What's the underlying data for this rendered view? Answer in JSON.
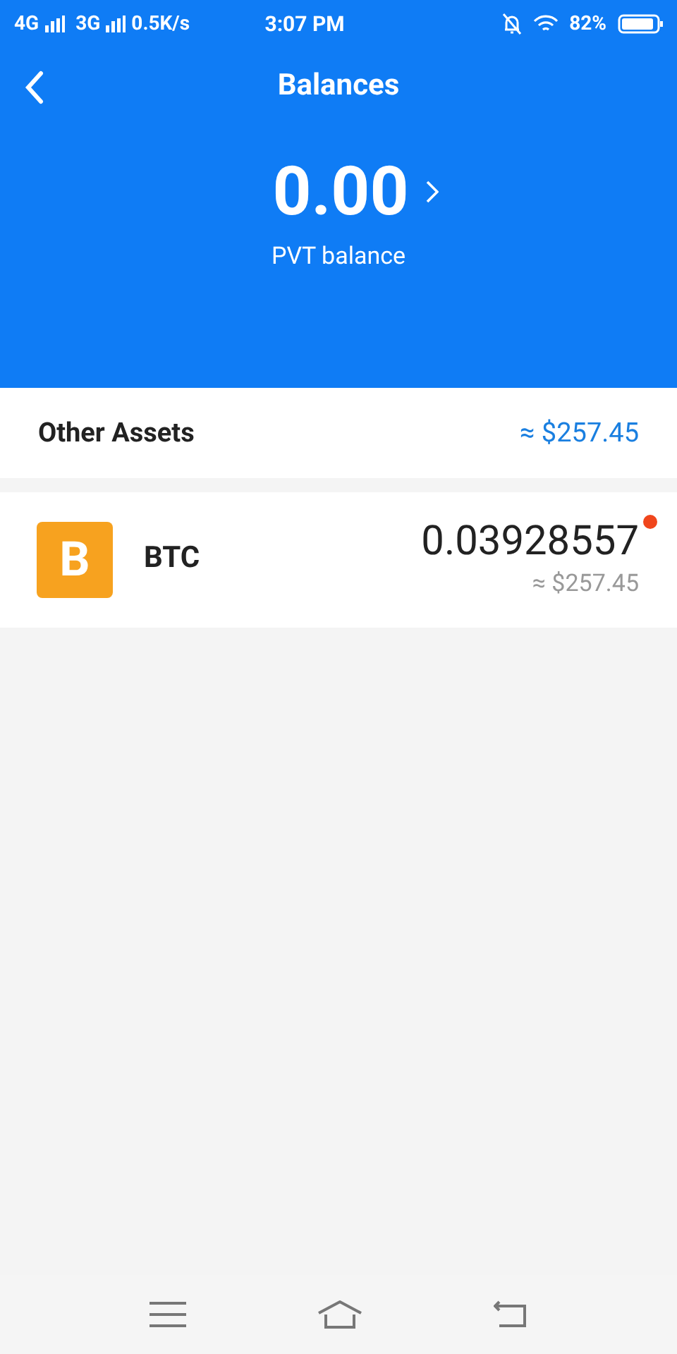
{
  "status_bar": {
    "network_1": "4G",
    "network_2": "3G",
    "speed": "0.5K/s",
    "time": "3:07 PM",
    "battery": "82%"
  },
  "header": {
    "title": "Balances"
  },
  "balance": {
    "amount": "0.00",
    "label": "PVT balance"
  },
  "other_assets": {
    "label": "Other Assets",
    "total": "≈ $257.45"
  },
  "assets": [
    {
      "icon_glyph": "B",
      "name": "BTC",
      "amount": "0.03928557",
      "fiat": "≈ $257.45",
      "dot": true
    }
  ]
}
